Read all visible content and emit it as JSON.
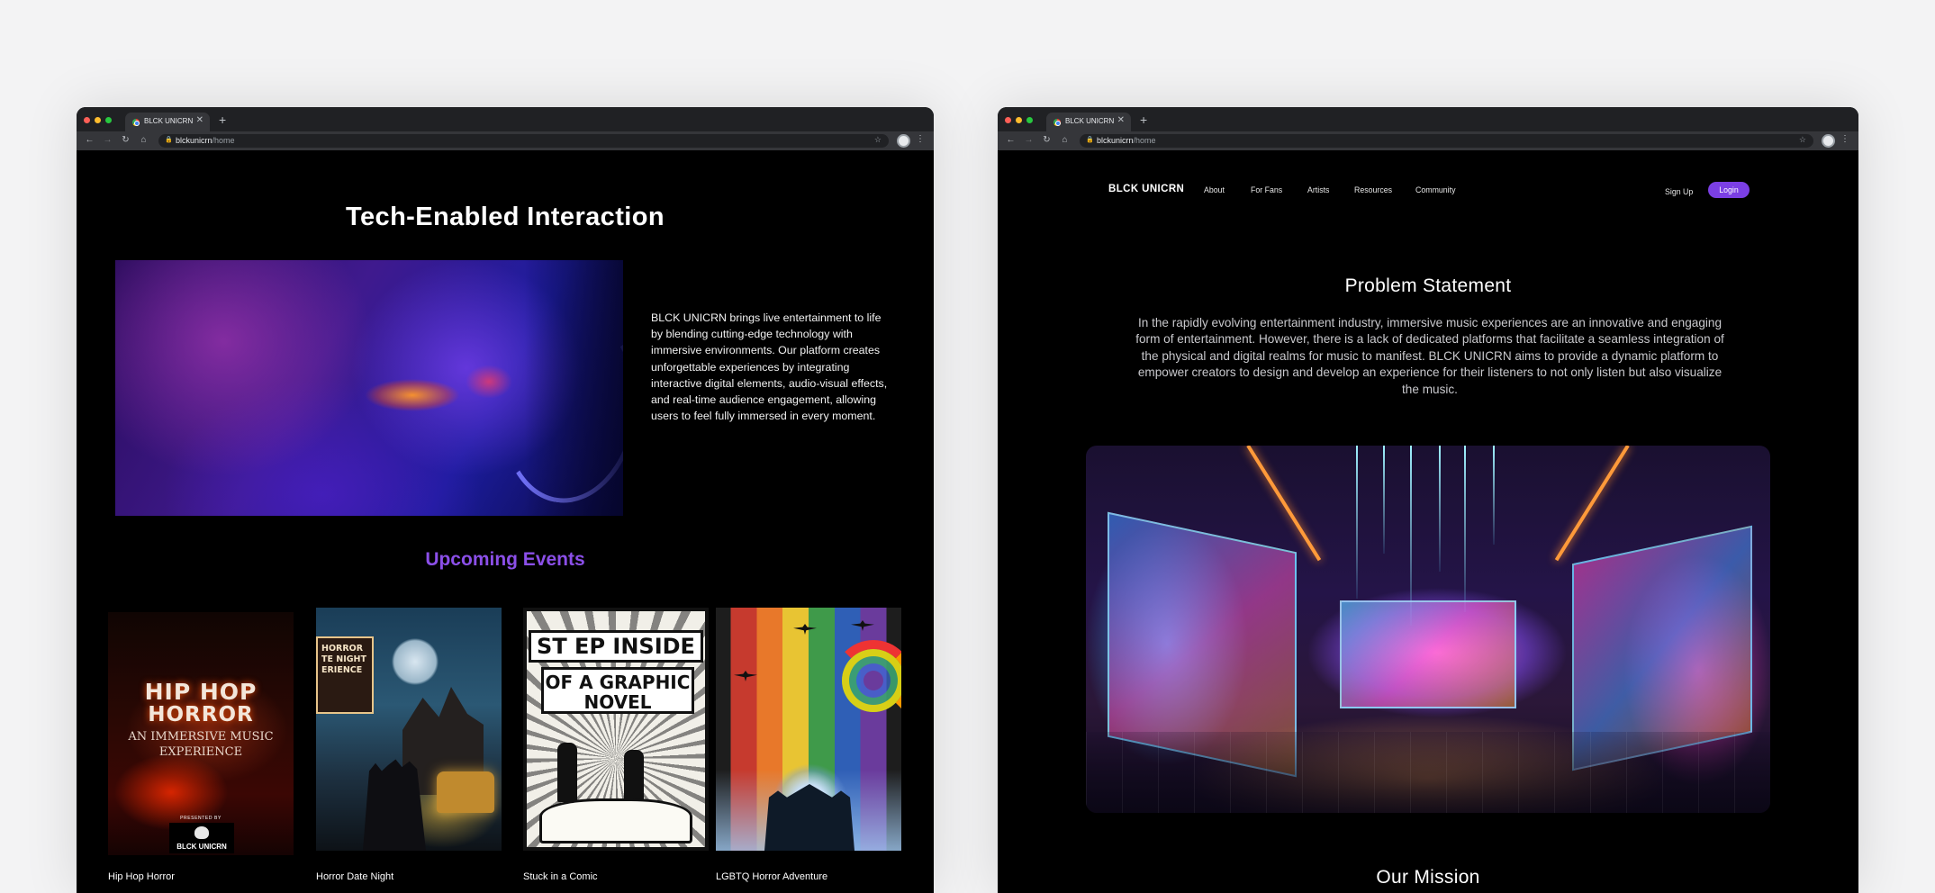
{
  "left_window": {
    "tab_title": "BLCK UNICRN",
    "url_host": "blckunicrn",
    "url_path": "/home",
    "heading": "Tech-Enabled Interaction",
    "description": "BLCK UNICRN brings live entertainment to life by blending cutting-edge technology with immersive environments. Our platform creates unforgettable experiences by integrating interactive digital elements, audio-visual effects, and real-time audience engagement, allowing users to feel fully immersed in every moment.",
    "events_heading": "Upcoming Events",
    "events": [
      {
        "label": "Hip Hop Horror",
        "poster_line1": "HIP HOP",
        "poster_line2": "HORROR",
        "poster_sub": "AN IMMERSIVE MUSIC EXPERIENCE",
        "poster_presented": "PRESENTED BY",
        "poster_logo": "BLCK UNICRN"
      },
      {
        "label": "Horror Date Night",
        "poster_marquee": "HORROR\nTE NIGHT\nERIENCE"
      },
      {
        "label": "Stuck in a Comic",
        "poster_line1": "ST EP INSIDE",
        "poster_line2": "OF A GRAPHIC NOVEL"
      },
      {
        "label": "LGBTQ Horror Adventure"
      }
    ]
  },
  "right_window": {
    "tab_title": "BLCK UNICRN",
    "url_host": "blckunicrn",
    "url_path": "/home",
    "brand": "BLCK UNICRN",
    "nav": [
      "About",
      "For Fans",
      "Artists",
      "Resources",
      "Community"
    ],
    "signup": "Sign Up",
    "login": "Login",
    "problem_heading": "Problem Statement",
    "problem_text": "In the rapidly evolving entertainment industry, immersive music experiences are an innovative and engaging form of entertainment. However, there is a lack of dedicated platforms that facilitate a seamless integration of the physical and digital realms for music to manifest. BLCK UNICRN aims to provide a dynamic platform to empower creators to design and develop an experience for their listeners to not only listen but also visualize the music.",
    "mission_heading": "Our Mission"
  },
  "browser": {
    "new_tab_glyph": "+",
    "close_glyph": "✕",
    "back_glyph": "←",
    "forward_glyph": "→",
    "reload_glyph": "↻",
    "home_glyph": "⌂",
    "star_glyph": "☆",
    "menu_glyph": "⋮",
    "traffic_light_colors": [
      "#ff5f57",
      "#febc2e",
      "#28c840"
    ]
  },
  "colors": {
    "accent_purple": "#8b4fe8",
    "login_button": "#7b3fe4",
    "page_background": "#000000"
  }
}
